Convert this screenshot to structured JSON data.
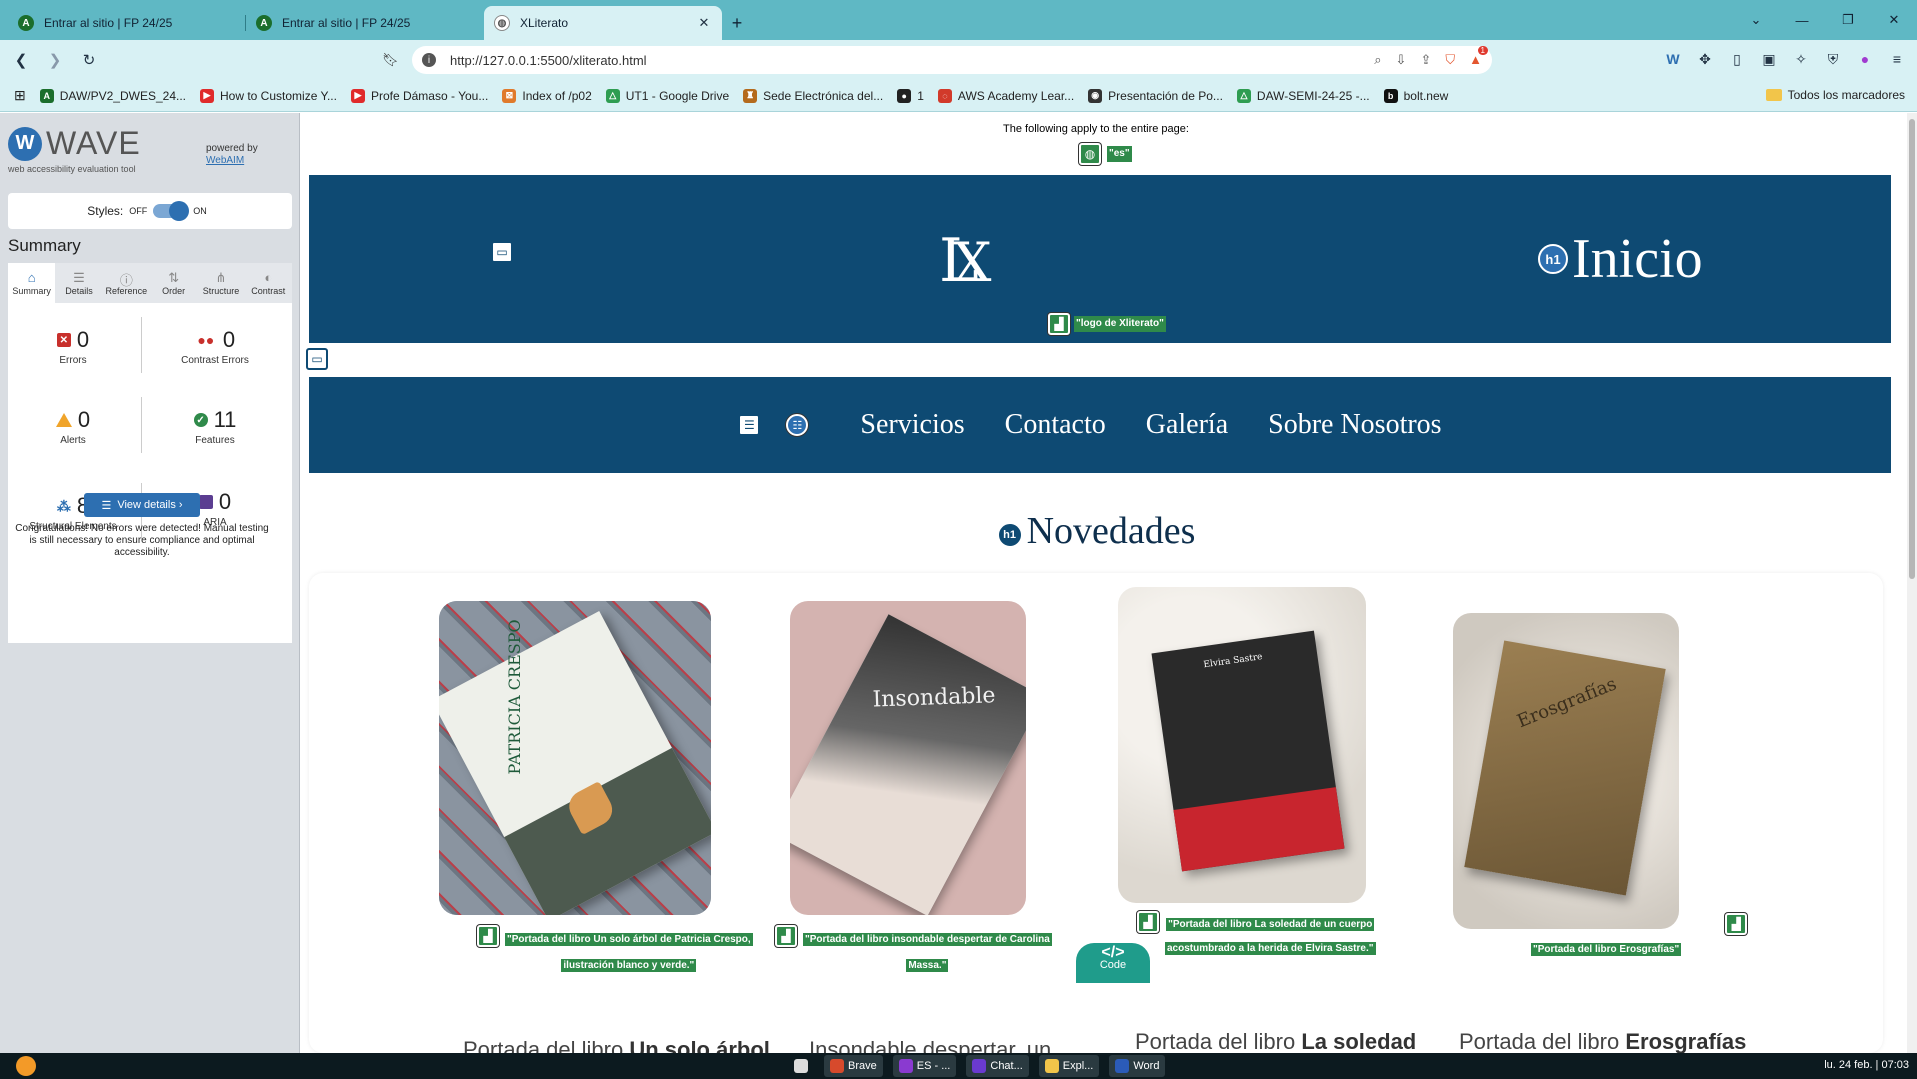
{
  "browser": {
    "tabs": [
      {
        "label": "Entrar al sitio | FP 24/25",
        "icon": "A"
      },
      {
        "label": "Entrar al sitio | FP 24/25",
        "icon": "A"
      },
      {
        "label": "XLiterato",
        "icon": "globe"
      }
    ],
    "url": "http://127.0.0.1:5500/xliterato.html",
    "bat_badge": "1",
    "bookmarks": [
      {
        "label": "DAW/PV2_DWES_24...",
        "color": "#1b6e2c",
        "glyph": "A"
      },
      {
        "label": "How to Customize Y...",
        "color": "#e02b2b",
        "glyph": "▶"
      },
      {
        "label": "Profe Dámaso - You...",
        "color": "#e02b2b",
        "glyph": "▶"
      },
      {
        "label": "Index of /p02",
        "color": "#e07a2b",
        "glyph": "⊠"
      },
      {
        "label": "UT1 - Google Drive",
        "color": "#2e9d51",
        "glyph": "△"
      },
      {
        "label": "Sede Electrónica del...",
        "color": "#b46a1c",
        "glyph": "♜"
      },
      {
        "label": "1",
        "color": "#222222",
        "glyph": "●"
      },
      {
        "label": "AWS Academy Lear...",
        "color": "#d23a2a",
        "glyph": "◌"
      },
      {
        "label": "Presentación de Po...",
        "color": "#333333",
        "glyph": "◉"
      },
      {
        "label": "DAW-SEMI-24-25 -...",
        "color": "#2e9d51",
        "glyph": "△"
      },
      {
        "label": "bolt.new",
        "color": "#111111",
        "glyph": "b"
      }
    ],
    "all_bookmarks": "Todos los marcadores"
  },
  "wave": {
    "logo_text": "WAVE",
    "tagline": "web accessibility evaluation tool",
    "powered_by": "powered by",
    "webaim": "WebAIM",
    "styles_label": "Styles:",
    "styles_off": "OFF",
    "styles_on": "ON",
    "summary_title": "Summary",
    "tabs": [
      "Summary",
      "Details",
      "Reference",
      "Order",
      "Structure",
      "Contrast"
    ],
    "stats": {
      "errors": {
        "value": "0",
        "label": "Errors"
      },
      "contrast": {
        "value": "0",
        "label": "Contrast Errors"
      },
      "alerts": {
        "value": "0",
        "label": "Alerts"
      },
      "features": {
        "value": "11",
        "label": "Features"
      },
      "structural": {
        "value": "8",
        "label": "Structural Elements"
      },
      "aria": {
        "value": "0",
        "label": "ARIA"
      }
    },
    "view_details": "View details ›",
    "congrats": "Congratulations! No errors were detected! Manual testing is still necessary to ensure compliance and optimal accessibility."
  },
  "page": {
    "applies": "The following apply to the entire page:",
    "lang_alt": "\"es\"",
    "logo_alt": "\"logo de Xliterato\"",
    "hero_title": "Inicio",
    "nav": [
      "Servicios",
      "Contacto",
      "Galería",
      "Sobre Nosotros"
    ],
    "section_title": "Novedades",
    "h1_badge": "h1",
    "code_badge": "Code",
    "books": [
      {
        "alt_line1": "\"Portada del libro Un solo árbol de Patricia Crespo,",
        "alt_line2": "ilustración blanco y verde.\"",
        "title_prefix": "Portada del libro ",
        "title_bold": "Un solo árbol",
        "cover_text": "PATRICIA CRESPO"
      },
      {
        "alt_line1": "\"Portada del libro insondable despertar de Carolina",
        "alt_line2": "Massa.\"",
        "title_prefix": "Insondable despertar, un",
        "title_bold": "",
        "cover_text": "Insondable"
      },
      {
        "alt_line1": "\"Portada del libro La soledad de un cuerpo",
        "alt_line2": "acostumbrado a la herida de Elvira Sastre.\"",
        "title_prefix": "Portada del libro ",
        "title_bold": "La soledad",
        "cover_text": "Elvira Sastre"
      },
      {
        "alt_line1": "\"Portada del libro Erosgrafías\"",
        "alt_line2": "",
        "title_prefix": "Portada del libro ",
        "title_bold": "Erosgrafías",
        "cover_text": "Erosgrafías"
      }
    ]
  },
  "taskbar": {
    "items": [
      "Brave",
      "ES - ...",
      "Chat...",
      "Expl...",
      "Word"
    ],
    "clock": "lu. 24 feb. | 07:03"
  }
}
